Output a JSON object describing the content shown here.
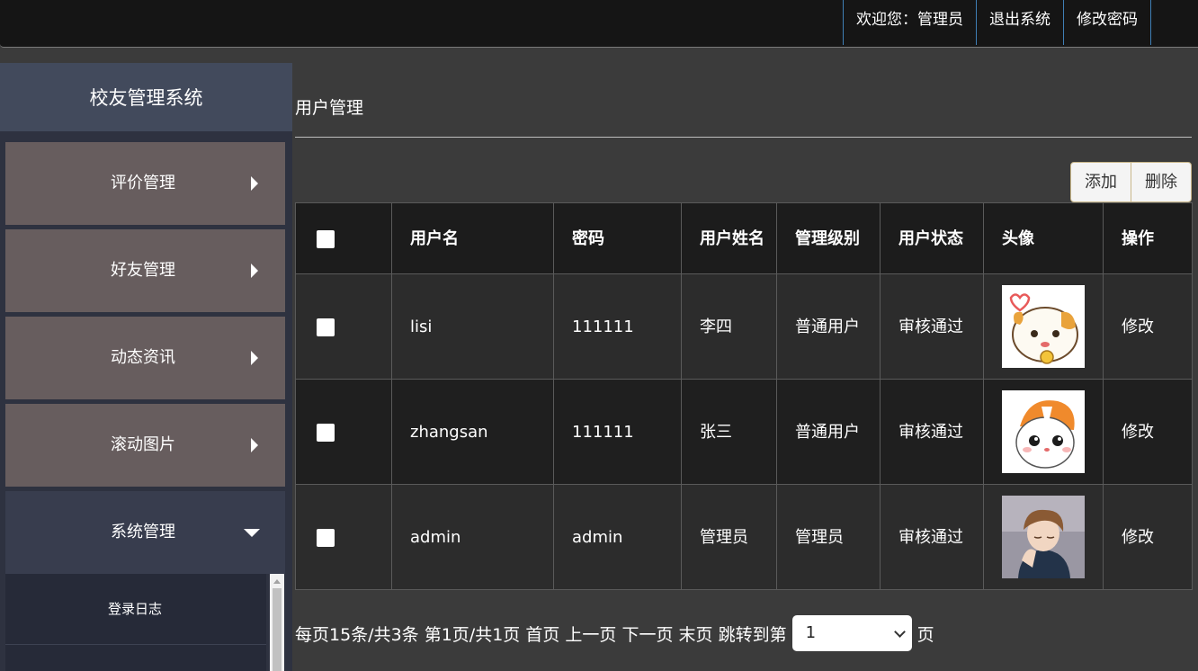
{
  "header": {
    "welcome": "欢迎您：管理员",
    "logout": "退出系统",
    "change_password": "修改密码"
  },
  "sidebar": {
    "title": "校友管理系统",
    "items": [
      {
        "label": "评价管理"
      },
      {
        "label": "好友管理"
      },
      {
        "label": "动态资讯"
      },
      {
        "label": "滚动图片"
      },
      {
        "label": "系统管理"
      }
    ],
    "subitems": [
      {
        "label": "登录日志"
      }
    ]
  },
  "main": {
    "title": "用户管理",
    "add_label": "添加",
    "delete_label": "删除",
    "columns": [
      "用户名",
      "密码",
      "用户姓名",
      "管理级别",
      "用户状态",
      "头像",
      "操作"
    ],
    "rows": [
      {
        "username": "lisi",
        "password": "111111",
        "realname": "李四",
        "level": "普通用户",
        "status": "审核通过",
        "avatar": "cartoon-hamster-avatar",
        "action": "修改"
      },
      {
        "username": "zhangsan",
        "password": "111111",
        "realname": "张三",
        "level": "普通用户",
        "status": "审核通过",
        "avatar": "hamtaro-avatar",
        "action": "修改"
      },
      {
        "username": "admin",
        "password": "admin",
        "realname": "管理员",
        "level": "管理员",
        "status": "审核通过",
        "avatar": "anime-boy-avatar",
        "action": "修改"
      }
    ]
  },
  "pager": {
    "summary": "每页15条/共3条 第1页/共1页",
    "first": "首页",
    "prev": "上一页",
    "next": "下一页",
    "last": "末页",
    "jump_prefix": "跳转到第",
    "jump_value": "1",
    "jump_suffix": "页"
  }
}
